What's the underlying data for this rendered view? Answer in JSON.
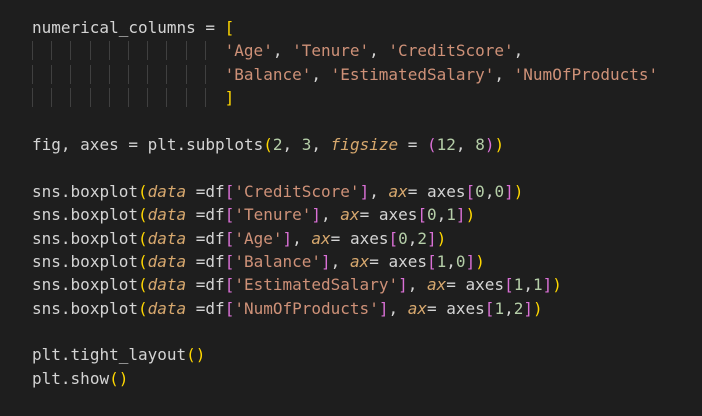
{
  "code": {
    "lines": [
      "numerical_columns = [",
      "'Age', 'Tenure', 'CreditScore',",
      "'Balance', 'EstimatedSalary', 'NumOfProducts'",
      "]",
      "",
      "fig, axes = plt.subplots(2, 3, figsize = (12, 8))",
      "",
      "sns.boxplot(data =df['CreditScore'], ax= axes[0,0])",
      "sns.boxplot(data =df['Tenure'], ax= axes[0,1])",
      "sns.boxplot(data =df['Age'], ax= axes[0,2])",
      "sns.boxplot(data =df['Balance'], ax= axes[1,0])",
      "sns.boxplot(data =df['EstimatedSalary'], ax= axes[1,1])",
      "sns.boxplot(data =df['NumOfProducts'], ax= axes[1,2])",
      "",
      "plt.tight_layout()",
      "plt.show()"
    ]
  },
  "colors": {
    "background": "#1e1e1e",
    "text": "#d4d4d4",
    "string": "#ce9178",
    "number": "#b5cea8",
    "keyword_param": "#d7a86e",
    "bracket_yellow": "#ffd700",
    "bracket_purple": "#da70d6",
    "bracket_blue": "#179fff"
  }
}
